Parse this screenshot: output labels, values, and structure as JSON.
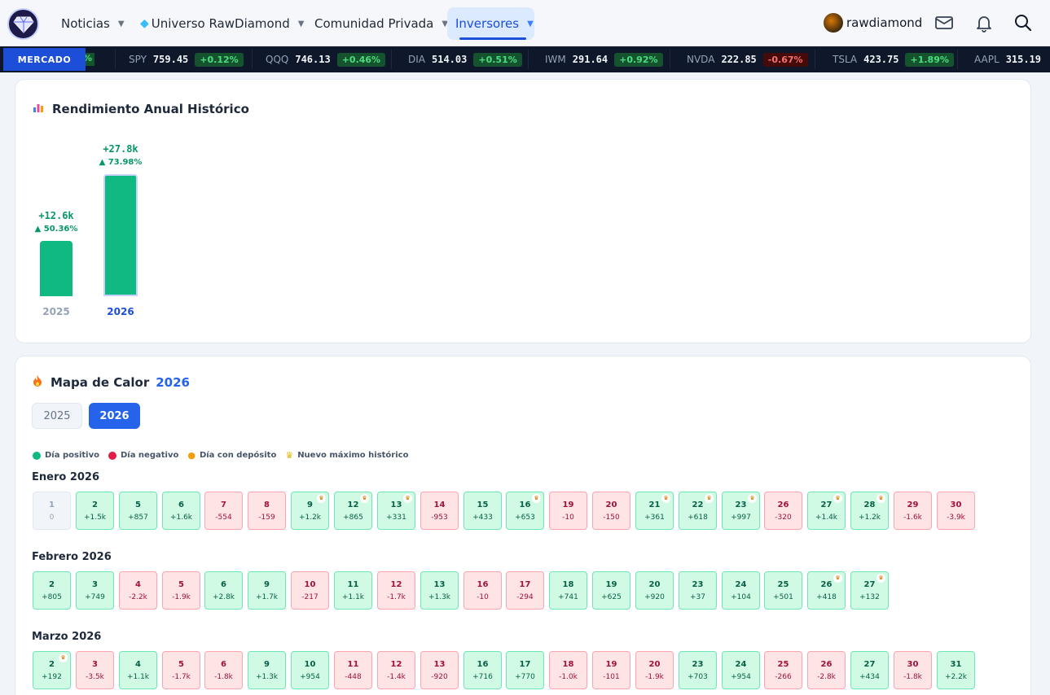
{
  "nav": {
    "items": [
      {
        "label": "Noticias"
      },
      {
        "label": "Universo RawDiamond"
      },
      {
        "label": "Comunidad Privada"
      },
      {
        "label": "Inversores"
      }
    ],
    "user": "rawdiamond"
  },
  "ticker": {
    "label": "MERCADO",
    "cut_fragment": "%",
    "items": [
      {
        "sym": "SPY",
        "price": "759.45",
        "chg": "+0.12%",
        "dir": "up"
      },
      {
        "sym": "QQQ",
        "price": "746.13",
        "chg": "+0.46%",
        "dir": "up"
      },
      {
        "sym": "DIA",
        "price": "514.03",
        "chg": "+0.51%",
        "dir": "up"
      },
      {
        "sym": "IWM",
        "price": "291.64",
        "chg": "+0.92%",
        "dir": "up"
      },
      {
        "sym": "NVDA",
        "price": "222.85",
        "chg": "-0.67%",
        "dir": "down"
      },
      {
        "sym": "TSLA",
        "price": "423.75",
        "chg": "+1.89%",
        "dir": "up"
      },
      {
        "sym": "AAPL",
        "price": "315.19",
        "chg": "",
        "dir": "up"
      }
    ]
  },
  "annual": {
    "title": "Rendimiento Anual Histórico",
    "bars": [
      {
        "year": "2025",
        "amount": "+12.6k",
        "pct": "▲ 50.36%",
        "value": 12.6,
        "selected": false
      },
      {
        "year": "2026",
        "amount": "+27.8k",
        "pct": "▲ 73.98%",
        "value": 27.8,
        "selected": true
      }
    ]
  },
  "heatmap": {
    "title": "Mapa de Calor",
    "year": "2026",
    "year_buttons": [
      {
        "label": "2025",
        "active": false
      },
      {
        "label": "2026",
        "active": true
      }
    ],
    "legend": [
      {
        "label": "Día positivo",
        "color": "#10b981"
      },
      {
        "label": "Día negativo",
        "color": "#e11d48"
      },
      {
        "label": "Día con depósito",
        "color": "#f59e0b"
      },
      {
        "label": "Nuevo máximo histórico",
        "color": "#eab308"
      }
    ],
    "months": [
      {
        "title": "Enero 2026",
        "days": [
          {
            "d": "1",
            "v": "0",
            "t": "neu"
          },
          {
            "d": "2",
            "v": "+1.5k",
            "t": "pos"
          },
          {
            "d": "5",
            "v": "+857",
            "t": "pos"
          },
          {
            "d": "6",
            "v": "+1.6k",
            "t": "pos"
          },
          {
            "d": "7",
            "v": "-554",
            "t": "neg"
          },
          {
            "d": "8",
            "v": "-159",
            "t": "neg"
          },
          {
            "d": "9",
            "v": "+1.2k",
            "t": "pos",
            "ath": true
          },
          {
            "d": "12",
            "v": "+865",
            "t": "pos",
            "ath": true
          },
          {
            "d": "13",
            "v": "+331",
            "t": "pos",
            "ath": true
          },
          {
            "d": "14",
            "v": "-953",
            "t": "neg"
          },
          {
            "d": "15",
            "v": "+433",
            "t": "pos"
          },
          {
            "d": "16",
            "v": "+653",
            "t": "pos",
            "ath": true
          },
          {
            "d": "19",
            "v": "-10",
            "t": "neg"
          },
          {
            "d": "20",
            "v": "-150",
            "t": "neg"
          },
          {
            "d": "21",
            "v": "+361",
            "t": "pos",
            "ath": true
          },
          {
            "d": "22",
            "v": "+618",
            "t": "pos",
            "ath": true
          },
          {
            "d": "23",
            "v": "+997",
            "t": "pos",
            "ath": true
          },
          {
            "d": "26",
            "v": "-320",
            "t": "neg"
          },
          {
            "d": "27",
            "v": "+1.4k",
            "t": "pos",
            "ath": true
          },
          {
            "d": "28",
            "v": "+1.2k",
            "t": "pos",
            "ath": true
          },
          {
            "d": "29",
            "v": "-1.6k",
            "t": "neg"
          },
          {
            "d": "30",
            "v": "-3.9k",
            "t": "neg"
          }
        ]
      },
      {
        "title": "Febrero 2026",
        "days": [
          {
            "d": "2",
            "v": "+805",
            "t": "pos"
          },
          {
            "d": "3",
            "v": "+749",
            "t": "pos"
          },
          {
            "d": "4",
            "v": "-2.2k",
            "t": "neg"
          },
          {
            "d": "5",
            "v": "-1.9k",
            "t": "neg"
          },
          {
            "d": "6",
            "v": "+2.8k",
            "t": "pos"
          },
          {
            "d": "9",
            "v": "+1.7k",
            "t": "pos"
          },
          {
            "d": "10",
            "v": "-217",
            "t": "neg"
          },
          {
            "d": "11",
            "v": "+1.1k",
            "t": "pos"
          },
          {
            "d": "12",
            "v": "-1.7k",
            "t": "neg"
          },
          {
            "d": "13",
            "v": "+1.3k",
            "t": "pos"
          },
          {
            "d": "16",
            "v": "-10",
            "t": "neg"
          },
          {
            "d": "17",
            "v": "-294",
            "t": "neg"
          },
          {
            "d": "18",
            "v": "+741",
            "t": "pos"
          },
          {
            "d": "19",
            "v": "+625",
            "t": "pos"
          },
          {
            "d": "20",
            "v": "+920",
            "t": "pos"
          },
          {
            "d": "23",
            "v": "+37",
            "t": "pos"
          },
          {
            "d": "24",
            "v": "+104",
            "t": "pos"
          },
          {
            "d": "25",
            "v": "+501",
            "t": "pos"
          },
          {
            "d": "26",
            "v": "+418",
            "t": "pos",
            "ath": true
          },
          {
            "d": "27",
            "v": "+132",
            "t": "pos",
            "ath": true
          }
        ]
      },
      {
        "title": "Marzo 2026",
        "days": [
          {
            "d": "2",
            "v": "+192",
            "t": "pos",
            "ath": true
          },
          {
            "d": "3",
            "v": "-3.5k",
            "t": "neg"
          },
          {
            "d": "4",
            "v": "+1.1k",
            "t": "pos"
          },
          {
            "d": "5",
            "v": "-1.7k",
            "t": "neg"
          },
          {
            "d": "6",
            "v": "-1.8k",
            "t": "neg"
          },
          {
            "d": "9",
            "v": "+1.3k",
            "t": "pos"
          },
          {
            "d": "10",
            "v": "+954",
            "t": "pos"
          },
          {
            "d": "11",
            "v": "-448",
            "t": "neg"
          },
          {
            "d": "12",
            "v": "-1.4k",
            "t": "neg"
          },
          {
            "d": "13",
            "v": "-920",
            "t": "neg"
          },
          {
            "d": "16",
            "v": "+716",
            "t": "pos"
          },
          {
            "d": "17",
            "v": "+770",
            "t": "pos"
          },
          {
            "d": "18",
            "v": "-1.0k",
            "t": "neg"
          },
          {
            "d": "19",
            "v": "-101",
            "t": "neg"
          },
          {
            "d": "20",
            "v": "-1.9k",
            "t": "neg"
          },
          {
            "d": "23",
            "v": "+703",
            "t": "pos"
          },
          {
            "d": "24",
            "v": "+954",
            "t": "pos"
          },
          {
            "d": "25",
            "v": "-266",
            "t": "neg"
          },
          {
            "d": "26",
            "v": "-2.8k",
            "t": "neg"
          },
          {
            "d": "27",
            "v": "+434",
            "t": "pos"
          },
          {
            "d": "30",
            "v": "-1.8k",
            "t": "neg"
          },
          {
            "d": "31",
            "v": "+2.2k",
            "t": "pos"
          }
        ]
      }
    ]
  }
}
